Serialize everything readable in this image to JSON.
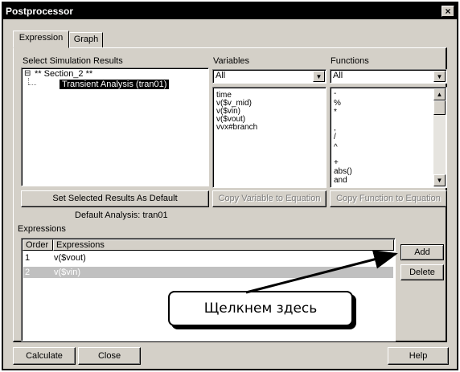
{
  "window": {
    "title": "Postprocessor",
    "close_glyph": "×"
  },
  "tabs": [
    {
      "label": "Expression",
      "active": true
    },
    {
      "label": "Graph",
      "active": false
    }
  ],
  "simulation_results": {
    "label": "Select Simulation Results",
    "tree_toggle": "⊟",
    "tree_root": "** Section_2 **",
    "tree_child": "Transient Analysis (tran01)"
  },
  "variables": {
    "label": "Variables",
    "filter_value": "All",
    "items": [
      "time",
      "v($v_mid)",
      "v($vin)",
      "v($vout)",
      "vvx#branch"
    ]
  },
  "functions": {
    "label": "Functions",
    "filter_value": "All",
    "items": [
      "-",
      "%",
      "*",
      ",",
      "/",
      "^",
      "+",
      "abs()",
      "and"
    ]
  },
  "buttons": {
    "set_default": "Set Selected Results As Default",
    "copy_variable": "Copy Variable to Equation",
    "copy_function": "Copy Function to Equation",
    "add": "Add",
    "delete": "Delete",
    "calculate": "Calculate",
    "close": "Close",
    "help": "Help"
  },
  "default_analysis_text": "Default Analysis: tran01",
  "expressions": {
    "label": "Expressions",
    "columns": [
      "Order",
      "Expressions"
    ],
    "rows": [
      {
        "order": "1",
        "expression": "v($vout)",
        "selected": false
      },
      {
        "order": "2",
        "expression": "v($vin)",
        "selected": true
      }
    ]
  },
  "callout": {
    "text": "Щелкнем здесь"
  },
  "icons": {
    "dropdown": "chevron-down-icon",
    "scroll_up": "arrow-up-icon",
    "scroll_down": "arrow-down-icon"
  }
}
